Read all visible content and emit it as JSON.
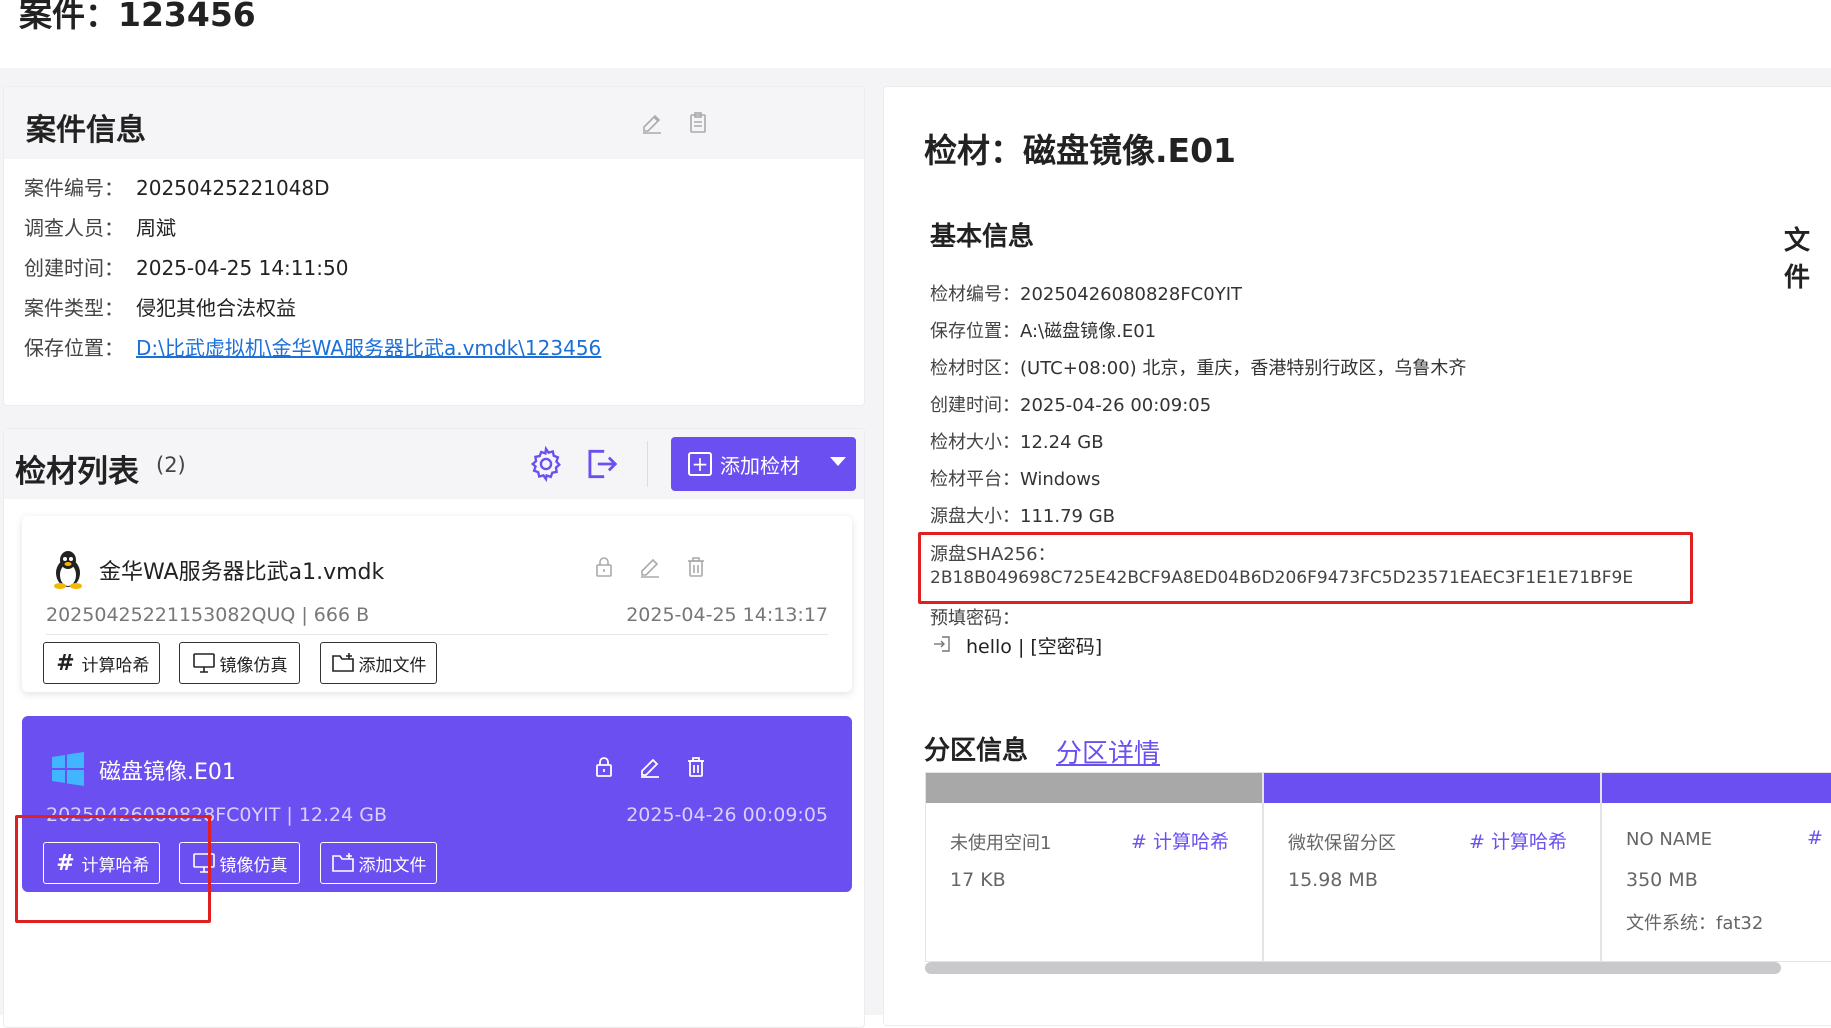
{
  "page": {
    "title": "案件：123456"
  },
  "case_info": {
    "title": "案件信息",
    "rows": [
      {
        "label": "案件编号：",
        "value": "20250425221048D"
      },
      {
        "label": "调查人员：",
        "value": "周斌"
      },
      {
        "label": "创建时间：",
        "value": "2025-04-25 14:11:50"
      },
      {
        "label": "案件类型：",
        "value": "侵犯其他合法权益"
      },
      {
        "label": "保存位置：",
        "value": "D:\\比武虚拟机\\金华WA服务器比武a.vmdk\\123456"
      }
    ],
    "icons": [
      "edit-icon",
      "clipboard-icon"
    ]
  },
  "evidence_list": {
    "title": "检材列表",
    "count": "(2)",
    "add_button": "添加检材",
    "items": [
      {
        "name": "金华WA服务器比武a1.vmdk",
        "meta": "20250425221153082QUQ | 666 B",
        "date": "2025-04-25 14:13:17",
        "os_icon": "linux-tux-icon",
        "buttons": [
          "计算哈希",
          "镜像仿真",
          "添加文件"
        ]
      },
      {
        "name": "磁盘镜像.E01",
        "meta": "20250426080828FC0YIT | 12.24 GB",
        "date": "2025-04-26 00:09:05",
        "os_icon": "windows-icon",
        "buttons": [
          "计算哈希",
          "镜像仿真",
          "添加文件"
        ]
      }
    ]
  },
  "evidence_detail": {
    "title": "检材：磁盘镜像.E01",
    "basic_title": "基本信息",
    "file_title_partial": "文件",
    "rows": [
      {
        "label": "检材编号：",
        "value": "20250426080828FC0YIT"
      },
      {
        "label": "保存位置：",
        "value": "A:\\磁盘镜像.E01"
      },
      {
        "label": "检材时区：",
        "value": "(UTC+08:00) 北京，重庆，香港特别行政区，乌鲁木齐"
      },
      {
        "label": "创建时间：",
        "value": "2025-04-26 00:09:05"
      },
      {
        "label": "检材大小：",
        "value": "12.24 GB"
      },
      {
        "label": "检材平台：",
        "value": "Windows"
      },
      {
        "label": "源盘大小：",
        "value": "111.79 GB"
      }
    ],
    "sha_label": "源盘SHA256：",
    "sha_value": "2B18B049698C725E42BCF9A8ED04B6D206F9473FC5D23571EAEC3F1E1E71BF9E",
    "password_label": "预填密码：",
    "password_value": "hello | [空密码]"
  },
  "partitions": {
    "title": "分区信息",
    "detail_link": "分区详情",
    "items": [
      {
        "name": "未使用空间1",
        "hash": "# 计算哈希",
        "size": "17 KB",
        "fs": "",
        "bar_color": "#a8a8a8"
      },
      {
        "name": "微软保留分区",
        "hash": "# 计算哈希",
        "size": "15.98 MB",
        "fs": "",
        "bar_color": "#6b4ff0"
      },
      {
        "name": "NO NAME",
        "hash": "#",
        "size": "350 MB",
        "fs": "文件系统：fat32",
        "bar_color": "#6b4ff0"
      }
    ]
  },
  "colors": {
    "accent": "#6b4ff0",
    "highlight": "#e02020",
    "link": "#1a6fd8"
  }
}
